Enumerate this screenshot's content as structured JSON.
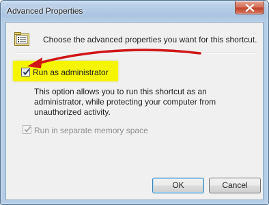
{
  "window": {
    "title": "Advanced Properties"
  },
  "header": {
    "text": "Choose the advanced properties you want for this shortcut."
  },
  "options": {
    "run_as_admin": {
      "label": "Run as administrator",
      "checked": true,
      "enabled": true
    },
    "description": "This option allows you to run this shortcut as an administrator, while protecting your computer from unauthorized activity.",
    "separate_memory": {
      "label": "Run in separate memory space",
      "checked": true,
      "enabled": false
    }
  },
  "buttons": {
    "ok": "OK",
    "cancel": "Cancel"
  },
  "colors": {
    "highlight": "#f5f500",
    "annotation_arrow": "#d01616"
  }
}
